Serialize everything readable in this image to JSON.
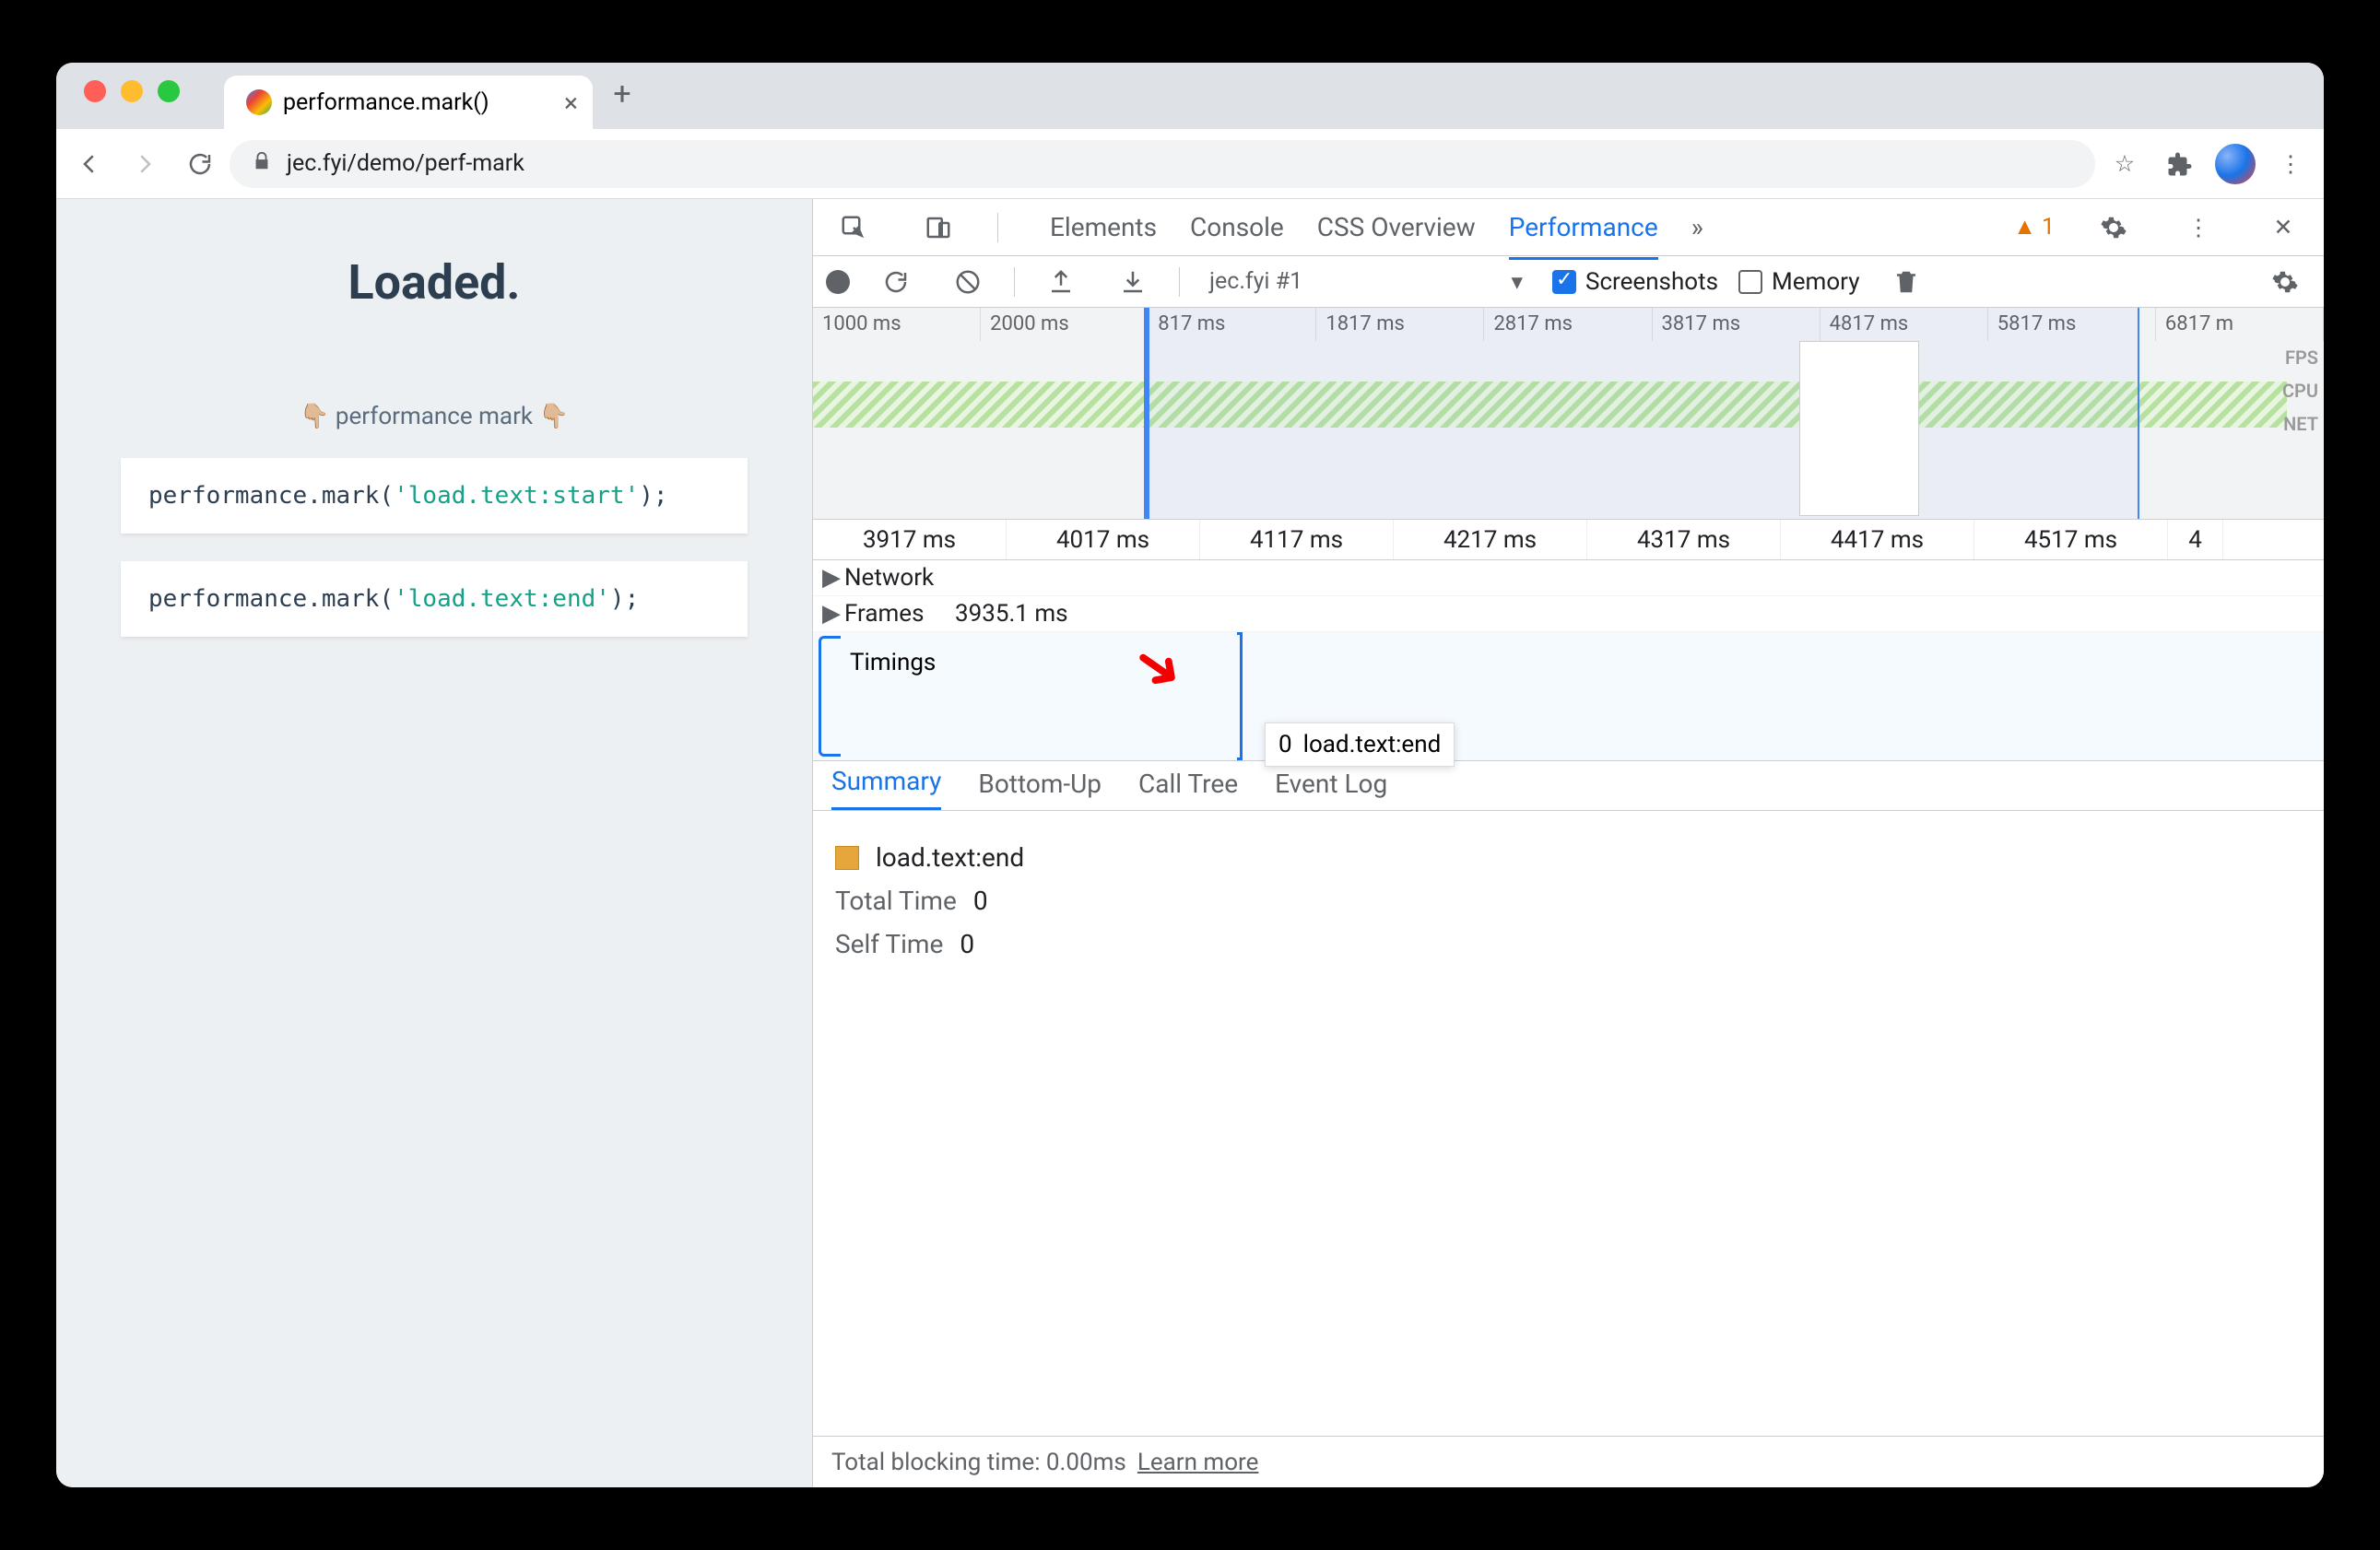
{
  "tab": {
    "title": "performance.mark()"
  },
  "address": {
    "url": "jec.fyi/demo/perf-mark"
  },
  "page": {
    "heading": "Loaded.",
    "subtitle": "👇🏼 performance mark 👇🏼",
    "code1_pre": "performance.mark(",
    "code1_str": "'load.text:start'",
    "code1_post": ");",
    "code2_pre": "performance.mark(",
    "code2_str": "'load.text:end'",
    "code2_post": ");"
  },
  "devtools": {
    "tabs": [
      "Elements",
      "Console",
      "CSS Overview",
      "Performance"
    ],
    "active_tab": "Performance",
    "more_tabs": "»",
    "warnings": "1",
    "toolbar": {
      "profile": "jec.fyi #1",
      "screenshots": "Screenshots",
      "memory": "Memory"
    },
    "overview_ticks": [
      "1000 ms",
      "2000 ms",
      "817 ms",
      "1817 ms",
      "2817 ms",
      "3817 ms",
      "4817 ms",
      "5817 ms",
      "6817 m"
    ],
    "overview_labels": [
      "FPS",
      "CPU",
      "NET"
    ],
    "ruler_ticks": [
      "3917 ms",
      "4017 ms",
      "4117 ms",
      "4217 ms",
      "4317 ms",
      "4417 ms",
      "4517 ms",
      "4"
    ],
    "tracks": {
      "network": "Network",
      "frames": "Frames",
      "frames_time": "3935.1 ms",
      "timings": "Timings"
    },
    "tooltip": {
      "value": "0",
      "name": "load.text:end"
    },
    "sub_tabs": [
      "Summary",
      "Bottom-Up",
      "Call Tree",
      "Event Log"
    ],
    "active_sub": "Summary",
    "summary": {
      "event_name": "load.text:end",
      "total_time_label": "Total Time",
      "total_time_value": "0",
      "self_time_label": "Self Time",
      "self_time_value": "0"
    },
    "footer": {
      "blocking": "Total blocking time: 0.00ms",
      "learn_more": "Learn more"
    }
  }
}
